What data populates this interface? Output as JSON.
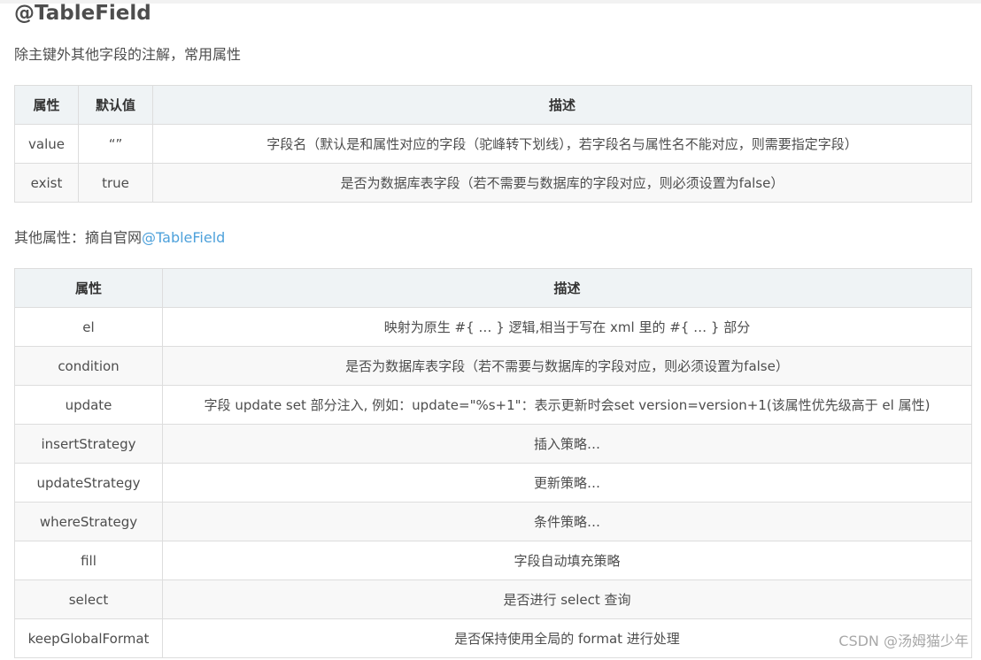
{
  "heading": "@TableField",
  "intro": "除主键外其他字段的注解，常用属性",
  "table1": {
    "headers": [
      "属性",
      "默认值",
      "描述"
    ],
    "rows": [
      [
        "value",
        "“”",
        "字段名（默认是和属性对应的字段（驼峰转下划线），若字段名与属性名不能对应，则需要指定字段）"
      ],
      [
        "exist",
        "true",
        "是否为数据库表字段（若不需要与数据库的字段对应，则必须设置为false）"
      ]
    ]
  },
  "other": {
    "prefix": "其他属性：摘自官网",
    "link": "@TableField"
  },
  "table2": {
    "headers": [
      "属性",
      "描述"
    ],
    "rows": [
      [
        "el",
        "映射为原生 #{ … } 逻辑,相当于写在 xml 里的 #{ … } 部分"
      ],
      [
        "condition",
        "是否为数据库表字段（若不需要与数据库的字段对应，则必须设置为false）"
      ],
      [
        "update",
        "字段 update set 部分注入, 例如：update=\"%s+1\"：表示更新时会set version=version+1(该属性优先级高于 el 属性)"
      ],
      [
        "insertStrategy",
        "插入策略…"
      ],
      [
        "updateStrategy",
        "更新策略…"
      ],
      [
        "whereStrategy",
        "条件策略…"
      ],
      [
        "fill",
        "字段自动填充策略"
      ],
      [
        "select",
        "是否进行 select 查询"
      ],
      [
        "keepGlobalFormat",
        "是否保持使用全局的 format 进行处理"
      ]
    ]
  },
  "watermark": "CSDN @汤姆猫少年"
}
